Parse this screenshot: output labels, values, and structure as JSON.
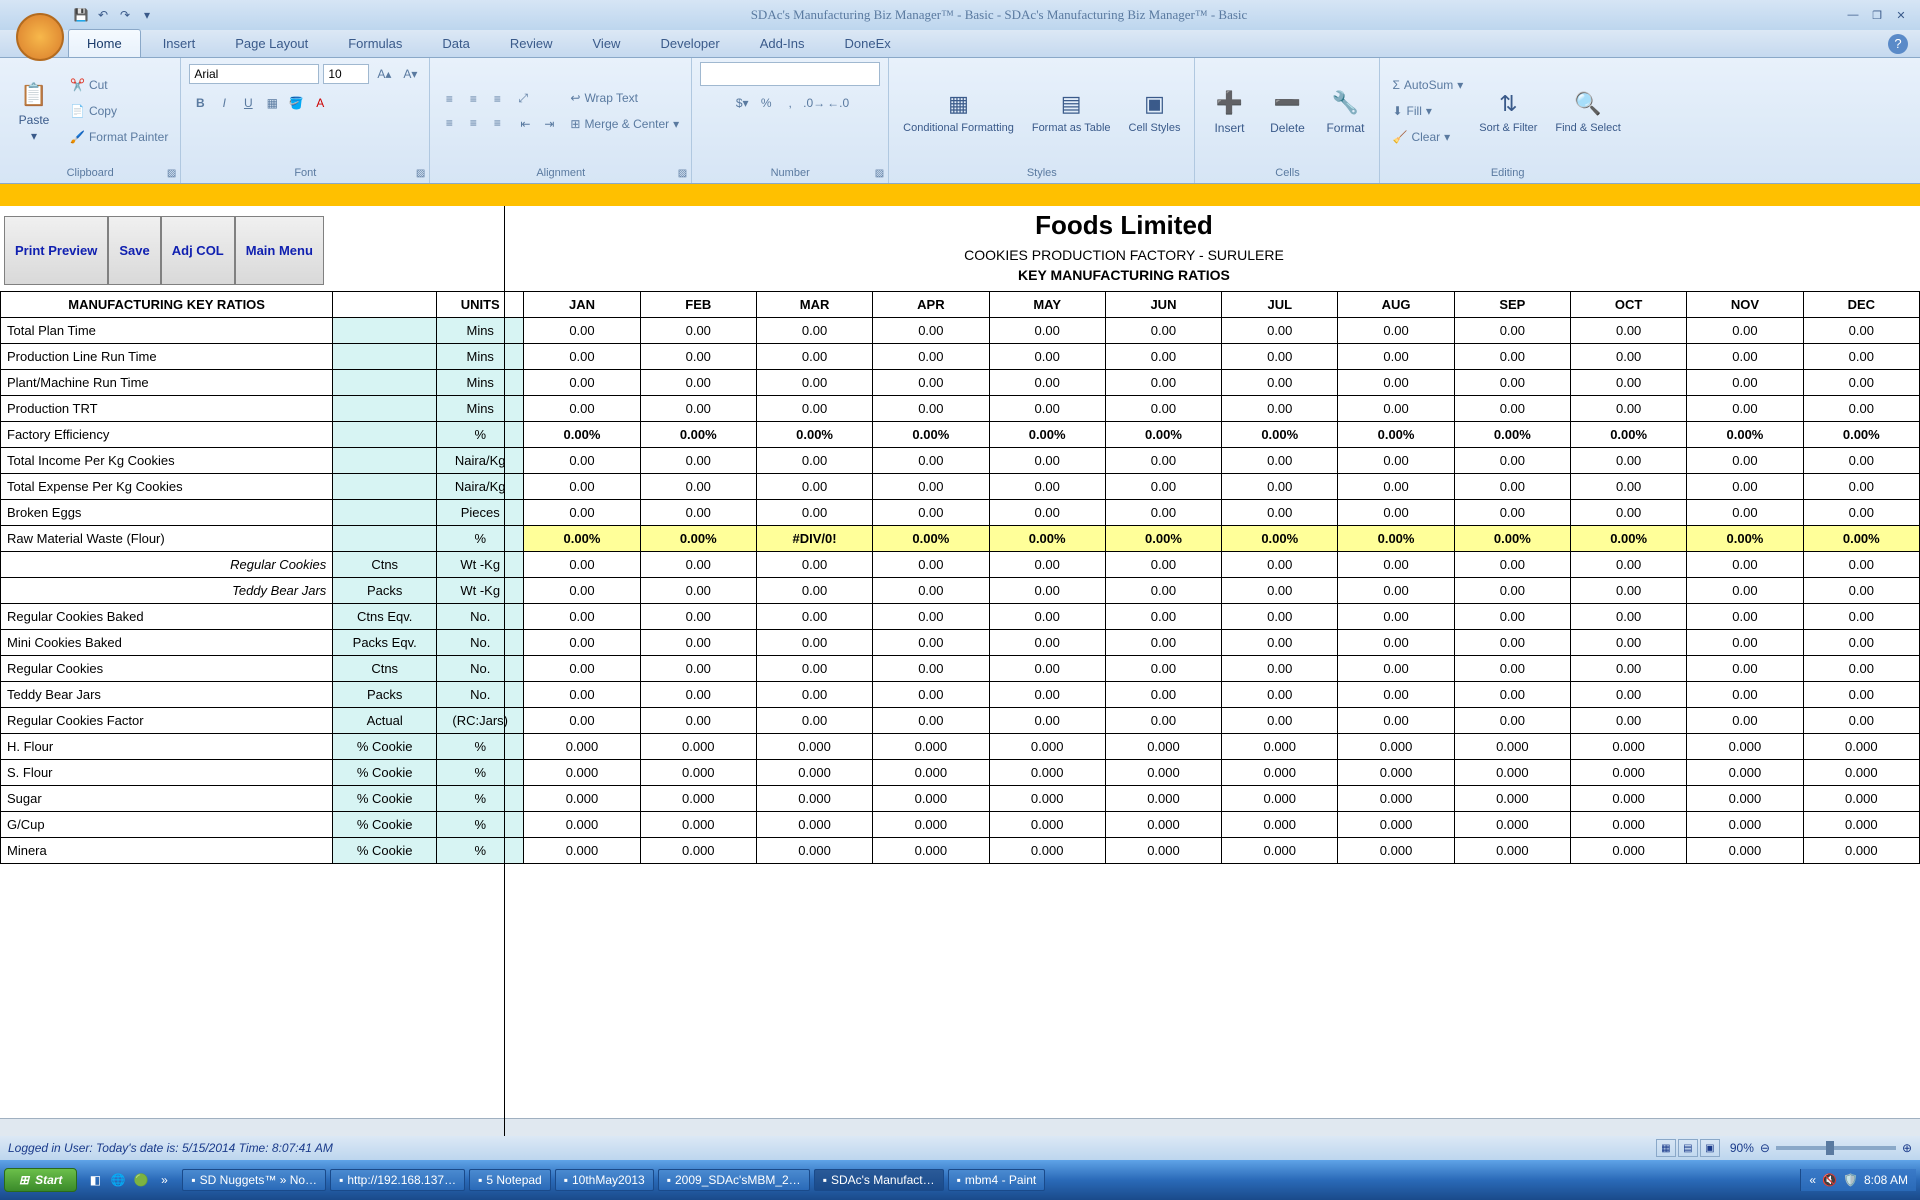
{
  "app": {
    "title": "SDAc's Manufacturing Biz Manager™ - Basic - SDAc's Manufacturing Biz Manager™ - Basic"
  },
  "ribbon": {
    "tabs": [
      "Home",
      "Insert",
      "Page Layout",
      "Formulas",
      "Data",
      "Review",
      "View",
      "Developer",
      "Add-Ins",
      "DoneEx"
    ],
    "active": 0,
    "clipboard": {
      "label": "Clipboard",
      "paste": "Paste",
      "cut": "Cut",
      "copy": "Copy",
      "fmtpaint": "Format Painter"
    },
    "font": {
      "label": "Font",
      "name": "Arial",
      "size": "10"
    },
    "alignment": {
      "label": "Alignment",
      "wrap": "Wrap Text",
      "merge": "Merge & Center"
    },
    "number": {
      "label": "Number"
    },
    "styles": {
      "label": "Styles",
      "cond": "Conditional Formatting",
      "fmtbl": "Format as Table",
      "cellst": "Cell Styles"
    },
    "cells": {
      "label": "Cells",
      "insert": "Insert",
      "delete": "Delete",
      "format": "Format"
    },
    "editing": {
      "label": "Editing",
      "autosum": "AutoSum",
      "fill": "Fill",
      "clear": "Clear",
      "sort": "Sort & Filter",
      "find": "Find & Select"
    }
  },
  "toolbar": {
    "printPreview": "Print Preview",
    "save": "Save",
    "adjCol": "Adj COL",
    "mainMenu": "Main Menu"
  },
  "header": {
    "company": "Foods Limited",
    "factory": "COOKIES PRODUCTION FACTORY - SURULERE",
    "report": "KEY MANUFACTURING RATIOS"
  },
  "grid": {
    "mainHeader": "MANUFACTURING KEY RATIOS",
    "unitsHeader": "UNITS",
    "months": [
      "JAN",
      "FEB",
      "MAR",
      "APR",
      "MAY",
      "JUN",
      "JUL",
      "AUG",
      "SEP",
      "OCT",
      "NOV",
      "DEC"
    ],
    "rows": [
      {
        "label": "Total Plan Time",
        "sub": "",
        "unit": "Mins",
        "type": "plain",
        "vals": [
          "0.00",
          "0.00",
          "0.00",
          "0.00",
          "0.00",
          "0.00",
          "0.00",
          "0.00",
          "0.00",
          "0.00",
          "0.00",
          "0.00"
        ]
      },
      {
        "label": "Production Line Run Time",
        "sub": "",
        "unit": "Mins",
        "type": "plain",
        "vals": [
          "0.00",
          "0.00",
          "0.00",
          "0.00",
          "0.00",
          "0.00",
          "0.00",
          "0.00",
          "0.00",
          "0.00",
          "0.00",
          "0.00"
        ]
      },
      {
        "label": "Plant/Machine Run Time",
        "sub": "",
        "unit": "Mins",
        "type": "plain",
        "vals": [
          "0.00",
          "0.00",
          "0.00",
          "0.00",
          "0.00",
          "0.00",
          "0.00",
          "0.00",
          "0.00",
          "0.00",
          "0.00",
          "0.00"
        ]
      },
      {
        "label": "Production TRT",
        "sub": "",
        "unit": "Mins",
        "type": "plain",
        "vals": [
          "0.00",
          "0.00",
          "0.00",
          "0.00",
          "0.00",
          "0.00",
          "0.00",
          "0.00",
          "0.00",
          "0.00",
          "0.00",
          "0.00"
        ]
      },
      {
        "label": "Factory Efficiency",
        "sub": "",
        "unit": "%",
        "type": "bold",
        "vals": [
          "0.00%",
          "0.00%",
          "0.00%",
          "0.00%",
          "0.00%",
          "0.00%",
          "0.00%",
          "0.00%",
          "0.00%",
          "0.00%",
          "0.00%",
          "0.00%"
        ]
      },
      {
        "label": "Total Income Per Kg Cookies",
        "sub": "",
        "unit": "Naira/Kg",
        "type": "plain",
        "vals": [
          "0.00",
          "0.00",
          "0.00",
          "0.00",
          "0.00",
          "0.00",
          "0.00",
          "0.00",
          "0.00",
          "0.00",
          "0.00",
          "0.00"
        ]
      },
      {
        "label": "Total Expense Per Kg Cookies",
        "sub": "",
        "unit": "Naira/Kg",
        "type": "plain",
        "vals": [
          "0.00",
          "0.00",
          "0.00",
          "0.00",
          "0.00",
          "0.00",
          "0.00",
          "0.00",
          "0.00",
          "0.00",
          "0.00",
          "0.00"
        ]
      },
      {
        "label": "Broken Eggs",
        "sub": "",
        "unit": "Pieces",
        "type": "plain",
        "vals": [
          "0.00",
          "0.00",
          "0.00",
          "0.00",
          "0.00",
          "0.00",
          "0.00",
          "0.00",
          "0.00",
          "0.00",
          "0.00",
          "0.00"
        ]
      },
      {
        "label": "Raw Material Waste (Flour)",
        "sub": "",
        "unit": "%",
        "type": "yel",
        "vals": [
          "0.00%",
          "0.00%",
          "#DIV/0!",
          "0.00%",
          "0.00%",
          "0.00%",
          "0.00%",
          "0.00%",
          "0.00%",
          "0.00%",
          "0.00%",
          "0.00%"
        ]
      },
      {
        "label": "Regular Cookies",
        "sub": "Ctns",
        "unit": "Wt -Kg",
        "type": "ital",
        "vals": [
          "0.00",
          "0.00",
          "0.00",
          "0.00",
          "0.00",
          "0.00",
          "0.00",
          "0.00",
          "0.00",
          "0.00",
          "0.00",
          "0.00"
        ]
      },
      {
        "label": "Teddy Bear Jars",
        "sub": "Packs",
        "unit": "Wt -Kg",
        "type": "ital",
        "vals": [
          "0.00",
          "0.00",
          "0.00",
          "0.00",
          "0.00",
          "0.00",
          "0.00",
          "0.00",
          "0.00",
          "0.00",
          "0.00",
          "0.00"
        ]
      },
      {
        "label": "Regular Cookies Baked",
        "sub": "Ctns Eqv.",
        "unit": "No.",
        "type": "plain",
        "vals": [
          "0.00",
          "0.00",
          "0.00",
          "0.00",
          "0.00",
          "0.00",
          "0.00",
          "0.00",
          "0.00",
          "0.00",
          "0.00",
          "0.00"
        ]
      },
      {
        "label": "Mini Cookies Baked",
        "sub": "Packs Eqv.",
        "unit": "No.",
        "type": "plain",
        "vals": [
          "0.00",
          "0.00",
          "0.00",
          "0.00",
          "0.00",
          "0.00",
          "0.00",
          "0.00",
          "0.00",
          "0.00",
          "0.00",
          "0.00"
        ]
      },
      {
        "label": "Regular Cookies",
        "sub": "Ctns",
        "unit": "No.",
        "type": "plain",
        "vals": [
          "0.00",
          "0.00",
          "0.00",
          "0.00",
          "0.00",
          "0.00",
          "0.00",
          "0.00",
          "0.00",
          "0.00",
          "0.00",
          "0.00"
        ]
      },
      {
        "label": "Teddy Bear Jars",
        "sub": "Packs",
        "unit": "No.",
        "type": "plain",
        "vals": [
          "0.00",
          "0.00",
          "0.00",
          "0.00",
          "0.00",
          "0.00",
          "0.00",
          "0.00",
          "0.00",
          "0.00",
          "0.00",
          "0.00"
        ]
      },
      {
        "label": "Regular Cookies Factor",
        "sub": "Actual",
        "unit": "(RC:Jars)",
        "type": "plain",
        "vals": [
          "0.00",
          "0.00",
          "0.00",
          "0.00",
          "0.00",
          "0.00",
          "0.00",
          "0.00",
          "0.00",
          "0.00",
          "0.00",
          "0.00"
        ]
      },
      {
        "label": "H. Flour",
        "sub": "% Cookie",
        "unit": "%",
        "type": "plain",
        "vals": [
          "0.000",
          "0.000",
          "0.000",
          "0.000",
          "0.000",
          "0.000",
          "0.000",
          "0.000",
          "0.000",
          "0.000",
          "0.000",
          "0.000"
        ]
      },
      {
        "label": "S. Flour",
        "sub": "% Cookie",
        "unit": "%",
        "type": "plain",
        "vals": [
          "0.000",
          "0.000",
          "0.000",
          "0.000",
          "0.000",
          "0.000",
          "0.000",
          "0.000",
          "0.000",
          "0.000",
          "0.000",
          "0.000"
        ]
      },
      {
        "label": "Sugar",
        "sub": "% Cookie",
        "unit": "%",
        "type": "plain",
        "vals": [
          "0.000",
          "0.000",
          "0.000",
          "0.000",
          "0.000",
          "0.000",
          "0.000",
          "0.000",
          "0.000",
          "0.000",
          "0.000",
          "0.000"
        ]
      },
      {
        "label": "G/Cup",
        "sub": "% Cookie",
        "unit": "%",
        "type": "plain",
        "vals": [
          "0.000",
          "0.000",
          "0.000",
          "0.000",
          "0.000",
          "0.000",
          "0.000",
          "0.000",
          "0.000",
          "0.000",
          "0.000",
          "0.000"
        ]
      },
      {
        "label": "Minera",
        "sub": "% Cookie",
        "unit": "%",
        "type": "plain",
        "vals": [
          "0.000",
          "0.000",
          "0.000",
          "0.000",
          "0.000",
          "0.000",
          "0.000",
          "0.000",
          "0.000",
          "0.000",
          "0.000",
          "0.000"
        ]
      }
    ]
  },
  "status": {
    "text": "Logged in User:  Today's date is: 5/15/2014 Time: 8:07:41 AM",
    "zoom": "90%"
  },
  "taskbar": {
    "start": "Start",
    "items": [
      "SD Nuggets™ » No…",
      "http://192.168.137…",
      "5 Notepad",
      "10thMay2013",
      "2009_SDAc'sMBM_2…",
      "SDAc's Manufact…",
      "mbm4 - Paint"
    ],
    "time": "8:08 AM"
  }
}
